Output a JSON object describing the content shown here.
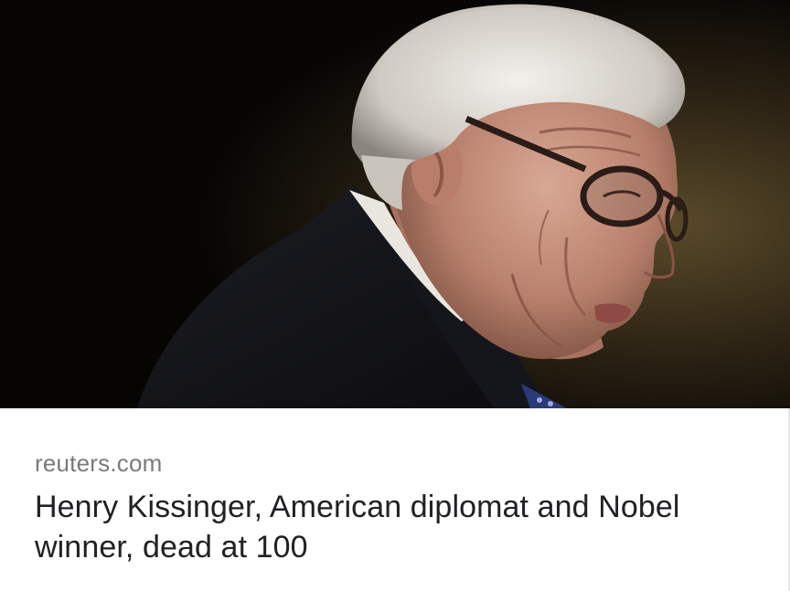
{
  "card": {
    "source_domain": "reuters.com",
    "headline": "Henry Kissinger, American diplomat and Nobel winner, dead at 100"
  },
  "image": {
    "name": "article-photo",
    "icon": "portrait-photo"
  },
  "colors": {
    "background": "#ffffff",
    "source_text": "#7a7a7a",
    "headline_text": "#202124",
    "photo_backdrop": "#0a0805"
  }
}
